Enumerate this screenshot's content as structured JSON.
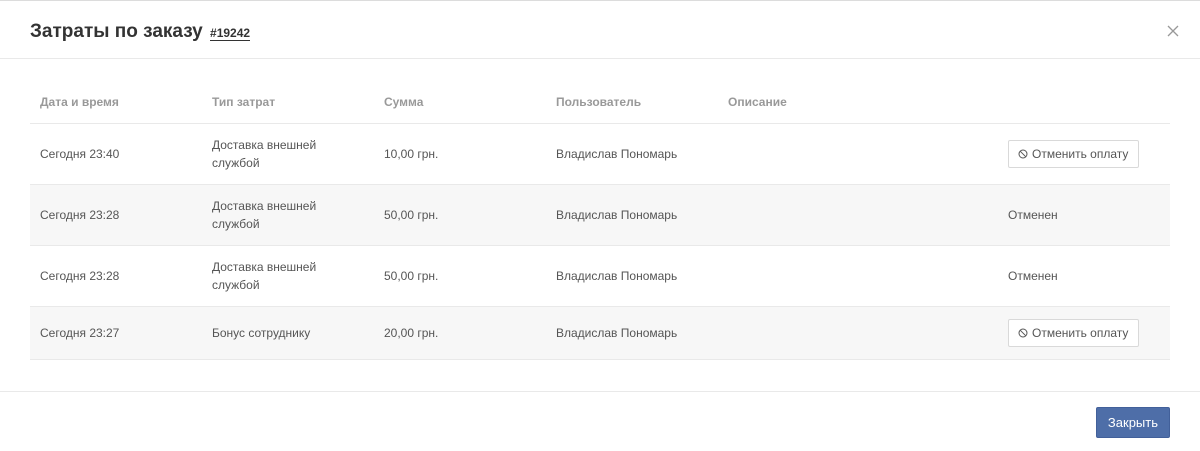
{
  "modal": {
    "title": "Затраты по заказу",
    "order_number": "#19242",
    "close_icon": "close-icon"
  },
  "table": {
    "headers": {
      "date": "Дата и время",
      "type": "Тип затрат",
      "amount": "Сумма",
      "user": "Пользователь",
      "description": "Описание"
    },
    "rows": [
      {
        "date": "Сегодня 23:40",
        "type": "Доставка внешней службой",
        "amount": "10,00 грн.",
        "user": "Владислав Пономарь",
        "description": "",
        "action": "Отменить оплату"
      },
      {
        "date": "Сегодня 23:28",
        "type": "Доставка внешней службой",
        "amount": "50,00 грн.",
        "user": "Владислав Пономарь",
        "description": "",
        "status": "Отменен"
      },
      {
        "date": "Сегодня 23:28",
        "type": "Доставка внешней службой",
        "amount": "50,00 грн.",
        "user": "Владислав Пономарь",
        "description": "",
        "status": "Отменен"
      },
      {
        "date": "Сегодня 23:27",
        "type": "Бонус сотруднику",
        "amount": "20,00 грн.",
        "user": "Владислав Пономарь",
        "description": "",
        "action": "Отменить оплату"
      }
    ]
  },
  "footer": {
    "close_label": "Закрыть"
  },
  "colors": {
    "primary_button": "#4e6ea8",
    "header_text": "#999999",
    "row_alt_bg": "#f7f7f7"
  }
}
